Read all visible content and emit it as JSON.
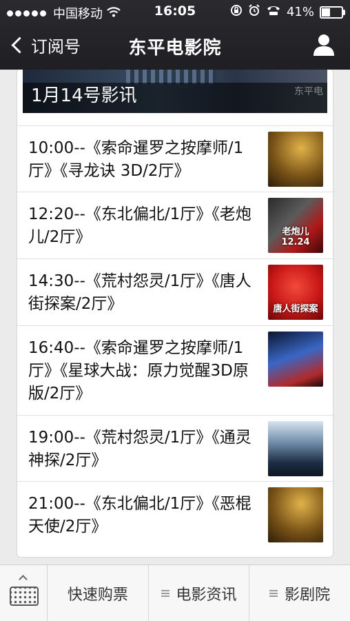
{
  "status": {
    "carrier": "中国移动",
    "time": "16:05",
    "battery": "41%",
    "battery_level": 0.41
  },
  "nav": {
    "back_label": "订阅号",
    "title": "东平电影院"
  },
  "banner": {
    "label": "1月14号影讯"
  },
  "schedule": [
    {
      "text": "10:00--《索命暹罗之按摩师/1厅》《寻龙诀 3D/2厅》",
      "poster": "p-gold"
    },
    {
      "text": "12:20--《东北偏北/1厅》《老炮儿/2厅》",
      "poster": "p-red",
      "poster_text": "老炮儿 12.24"
    },
    {
      "text": "14:30--《荒村怨灵/1厅》《唐人街探案/2厅》",
      "poster": "p-crimson",
      "poster_text": "唐人街探案"
    },
    {
      "text": "16:40--《索命暹罗之按摩师/1厅》《星球大战：原力觉醒3D原版/2厅》",
      "poster": "p-blue"
    },
    {
      "text": "19:00--《荒村怨灵/1厅》《通灵神探/2厅》",
      "poster": "p-steel"
    },
    {
      "text": "21:00--《东北偏北/1厅》《恶棍天使/2厅》",
      "poster": "p-gold"
    }
  ],
  "tabbar": {
    "tab1": "快速购票",
    "tab2": "电影资讯",
    "tab3": "影剧院"
  },
  "colors": {
    "header_bg": "#2b2b2f",
    "page_bg": "#ebebeb"
  }
}
